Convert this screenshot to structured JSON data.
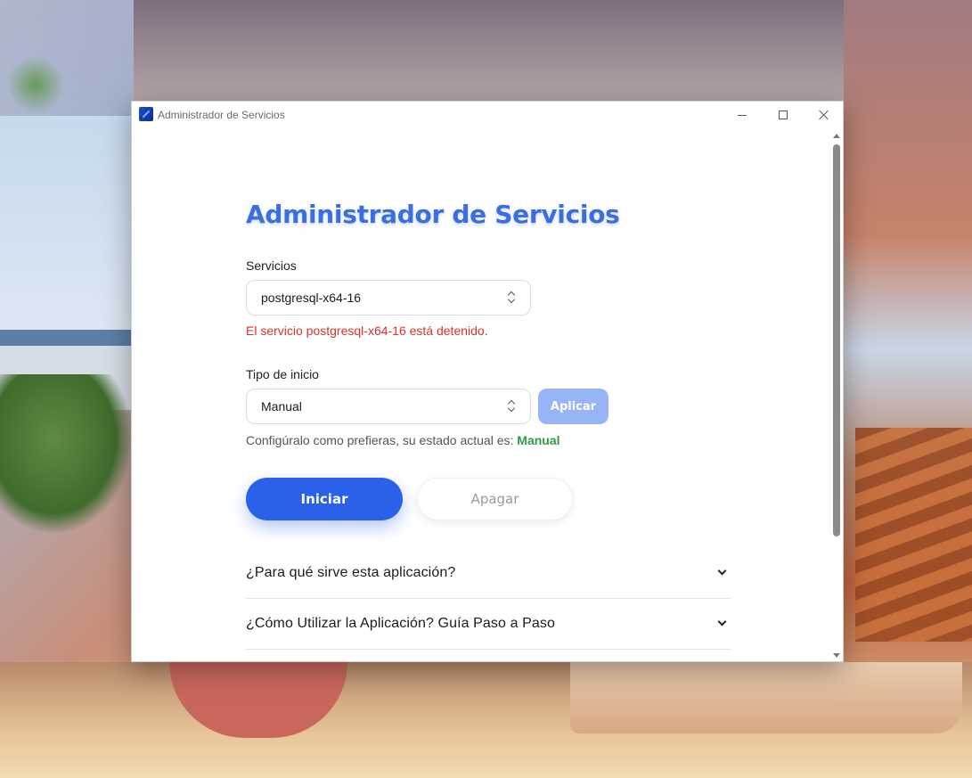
{
  "window": {
    "title": "Administrador de Servicios"
  },
  "page": {
    "title": "Administrador de Servicios"
  },
  "services": {
    "label": "Servicios",
    "selected": "postgresql-x64-16",
    "error_message": "El servicio postgresql-x64-16 está detenido."
  },
  "startup_type": {
    "label": "Tipo de inicio",
    "selected": "Manual",
    "apply_label": "Aplicar",
    "status_prefix": "Configúralo como prefieras, su estado actual es:",
    "status_value": "Manual"
  },
  "actions": {
    "start_label": "Iniciar",
    "stop_label": "Apagar"
  },
  "faq": [
    {
      "question": "¿Para qué sirve esta aplicación?"
    },
    {
      "question": "¿Cómo Utilizar la Aplicación? Guía Paso a Paso"
    }
  ],
  "colors": {
    "accent": "#2b60e8",
    "title": "#3b6fe0",
    "error": "#d9312b",
    "success": "#2e9c45",
    "apply_disabled": "#97b4f6"
  }
}
